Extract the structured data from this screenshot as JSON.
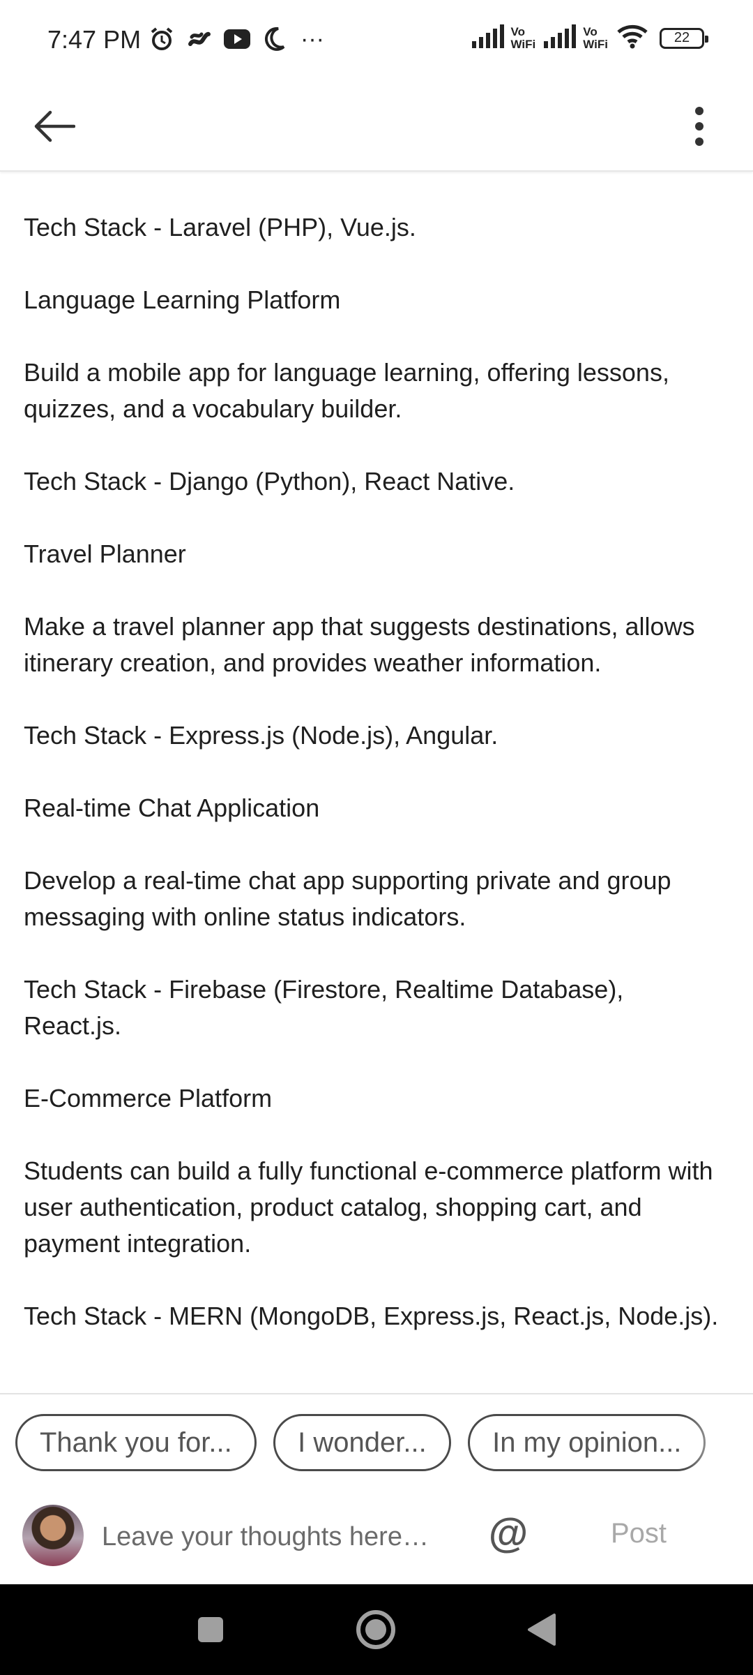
{
  "status_bar": {
    "time": "7:47 PM",
    "left_icons": [
      "alarm-icon",
      "swirl-app-icon",
      "youtube-icon",
      "moon-icon",
      "more-dots-icon"
    ],
    "more": "···",
    "sim1_label_top": "Vo",
    "sim1_label_bottom": "WiFi",
    "sim2_label_top": "Vo",
    "sim2_label_bottom": "WiFi",
    "battery": "22"
  },
  "app_bar": {
    "back_icon": "arrow-left-icon",
    "more_icon": "vertical-dots-icon"
  },
  "content": {
    "paragraphs": [
      "Tech Stack - Laravel (PHP), Vue.js.",
      "Language Learning Platform",
      "Build a mobile app for language learning, offering lessons, quizzes, and a vocabulary builder.",
      "Tech Stack - Django (Python), React Native.",
      "Travel Planner",
      "Make a travel planner app that suggests destinations, allows itinerary creation, and provides weather information.",
      "Tech Stack - Express.js (Node.js), Angular.",
      "Real-time Chat Application",
      "Develop a real-time chat app supporting private and group messaging with online status indicators.",
      "Tech Stack - Firebase (Firestore, Realtime Database), React.js.",
      "E-Commerce Platform",
      "Students can build a fully functional e-commerce platform with user authentication, product catalog, shopping cart, and payment integration.",
      "Tech Stack - MERN (MongoDB, Express.js, React.js, Node.js)."
    ]
  },
  "chips": [
    "Thank you for...",
    "I wonder...",
    "In my opinion..."
  ],
  "composer": {
    "placeholder": "Leave your thoughts here…",
    "at_symbol": "@",
    "post_label": "Post"
  },
  "nav_bar": {
    "buttons": [
      "recents-square-icon",
      "home-circle-icon",
      "back-triangle-icon"
    ]
  },
  "colors": {
    "text": "#1f1f1f",
    "chip_border": "#4a4a4a",
    "post_disabled": "#a8a8a8",
    "nav_bg": "#000000"
  }
}
